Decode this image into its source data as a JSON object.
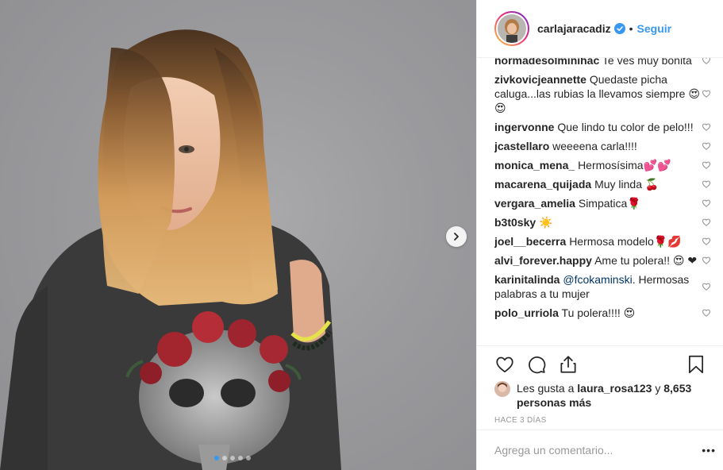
{
  "header": {
    "username": "carlajaracadiz",
    "verified": true,
    "separator": "•",
    "follow_label": "Seguir"
  },
  "comments": [
    {
      "user": "normadesolminihac",
      "text": "Te ves muy bonita"
    },
    {
      "user": "zivkovicjeannette",
      "text": "Quedaste picha caluga...las rubias la llevamos siempre 😍😍"
    },
    {
      "user": "ingervonne",
      "text": "Que lindo tu color de pelo!!!"
    },
    {
      "user": "jcastellaro",
      "text": "weeeena carla!!!!"
    },
    {
      "user": "monica_mena_",
      "text": "Hermosísima💕💕"
    },
    {
      "user": "macarena_quijada",
      "text": "Muy linda 🍒"
    },
    {
      "user": "vergara_amelia",
      "text": "Simpatica🌹"
    },
    {
      "user": "b3t0sky",
      "text": "☀️"
    },
    {
      "user": "joel__becerra",
      "text": "Hermosa modelo🌹💋"
    },
    {
      "user": "alvi_forever.happy",
      "text": "Ame tu polera!! 😍 ❤"
    },
    {
      "user": "karinitalinda",
      "mention": "@fcokaminski",
      "text": ". Hermosas palabras a tu mujer"
    },
    {
      "user": "polo_urriola",
      "text": "Tu polera!!!! 😍"
    }
  ],
  "likes": {
    "prefix": "Les gusta a",
    "liker": "laura_rosa123",
    "connector": "y",
    "count_text": "8,653 personas más"
  },
  "timestamp": "HACE 3 DÍAS",
  "add_comment": {
    "placeholder": "Agrega un comentario..."
  },
  "more_label": "•••",
  "carousel": {
    "total_slides": 5,
    "active_index": 0
  },
  "colors": {
    "link_blue": "#3897f0",
    "mention_blue": "#003569",
    "text": "#262626",
    "muted": "#999999",
    "border": "#efefef"
  }
}
